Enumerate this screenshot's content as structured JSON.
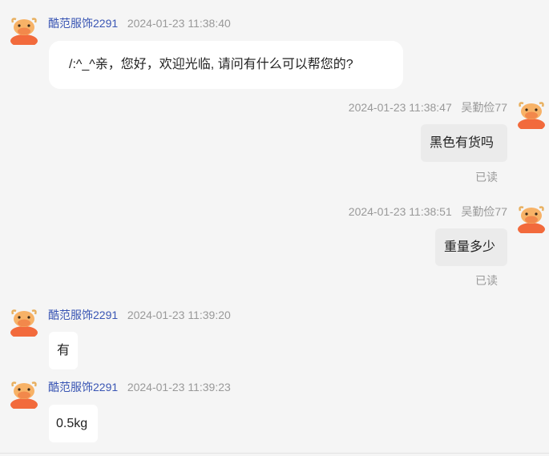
{
  "messages": [
    {
      "side": "left",
      "sender": "酷范服饰2291",
      "time": "2024-01-23 11:38:40",
      "text": "/:^_^亲，您好，欢迎光临, 请问有什么可以帮您的?"
    },
    {
      "side": "right",
      "sender": "吴勤俭77",
      "time": "2024-01-23 11:38:47",
      "text": "黑色有货吗",
      "status": "已读"
    },
    {
      "side": "right",
      "sender": "吴勤俭77",
      "time": "2024-01-23 11:38:51",
      "text": "重量多少",
      "status": "已读"
    },
    {
      "side": "left",
      "sender": "酷范服饰2291",
      "time": "2024-01-23 11:39:20",
      "text": "有"
    },
    {
      "side": "left",
      "sender": "酷范服饰2291",
      "time": "2024-01-23 11:39:23",
      "text": "0.5kg"
    }
  ],
  "avatar_icon": "cow-mascot-icon",
  "colors": {
    "background": "#f5f5f5",
    "shop_name": "#3a56b4",
    "meta_text": "#999999",
    "bubble_incoming": "#ffffff",
    "bubble_outgoing": "#ebebeb",
    "avatar_orange": "#f26a3c"
  }
}
